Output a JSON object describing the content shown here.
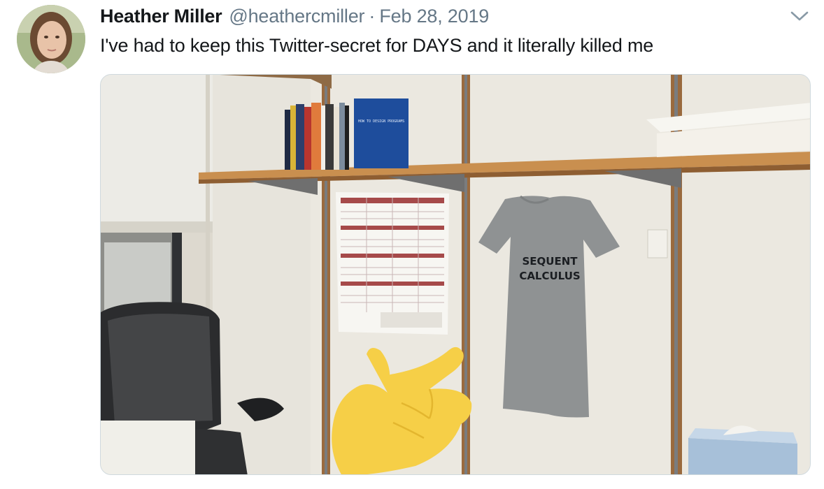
{
  "author": {
    "name": "Heather Miller",
    "handle": "@heathercmiller",
    "separator": "·",
    "date": "Feb 28, 2019",
    "avatar_icon": "user-avatar"
  },
  "tweet": {
    "text": "I've had to keep this Twitter-secret for DAYS and it literally killed me"
  },
  "menu": {
    "icon": "chevron-down-icon"
  },
  "photo": {
    "shirt_text_line1": "SEQUENT",
    "shirt_text_line2": "CALCULUS",
    "book_spine_text": "HOW TO DESIGN PROGRAMS",
    "pointer_emoji": "👉",
    "colors": {
      "wall": "#e6e3da",
      "shelf": "#c98f4f",
      "shirt": "#8f9293",
      "emoji": "#f6cf47"
    }
  },
  "colors": {
    "text_primary": "#14171a",
    "text_secondary": "#657786",
    "border": "#cfd9de"
  }
}
